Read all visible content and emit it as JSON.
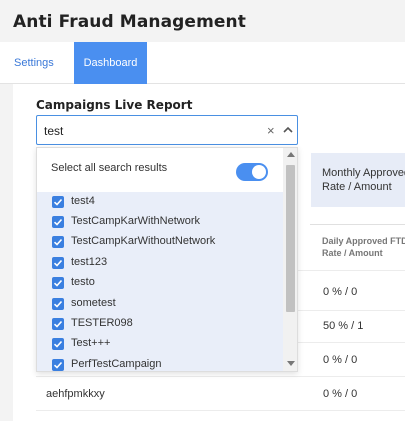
{
  "page": {
    "title": "Anti Fraud Management"
  },
  "tabs": {
    "settings": "Settings",
    "dashboard": "Dashboard"
  },
  "report": {
    "title": "Campaigns Live Report",
    "search": {
      "value": "test"
    }
  },
  "card": {
    "title": "Monthly Approved",
    "subtitle": "Rate / Amount"
  },
  "table": {
    "column_header_line1": "Daily Approved FTD",
    "column_header_line2": "Rate / Amount",
    "values": [
      "0 % / 0",
      "50 % / 1",
      "0 % / 0",
      "0 % / 0"
    ],
    "visible_row_name": "aehfpmkkxy"
  },
  "dropdown": {
    "select_all_label": "Select all search results",
    "select_all_on": true,
    "options": [
      {
        "label": "test4",
        "checked": true
      },
      {
        "label": "TestCampKarWithNetwork",
        "checked": true
      },
      {
        "label": "TestCampKarWithoutNetwork",
        "checked": true
      },
      {
        "label": "test123",
        "checked": true
      },
      {
        "label": "testo",
        "checked": true
      },
      {
        "label": "sometest",
        "checked": true
      },
      {
        "label": "TESTER098",
        "checked": true
      },
      {
        "label": "Test+++",
        "checked": true
      },
      {
        "label": "PerfTestCampaign",
        "checked": true
      }
    ]
  },
  "colors": {
    "accent": "#4a8ff0",
    "selected_bg": "#e9eef9",
    "card_bg": "#e7ecf7"
  }
}
